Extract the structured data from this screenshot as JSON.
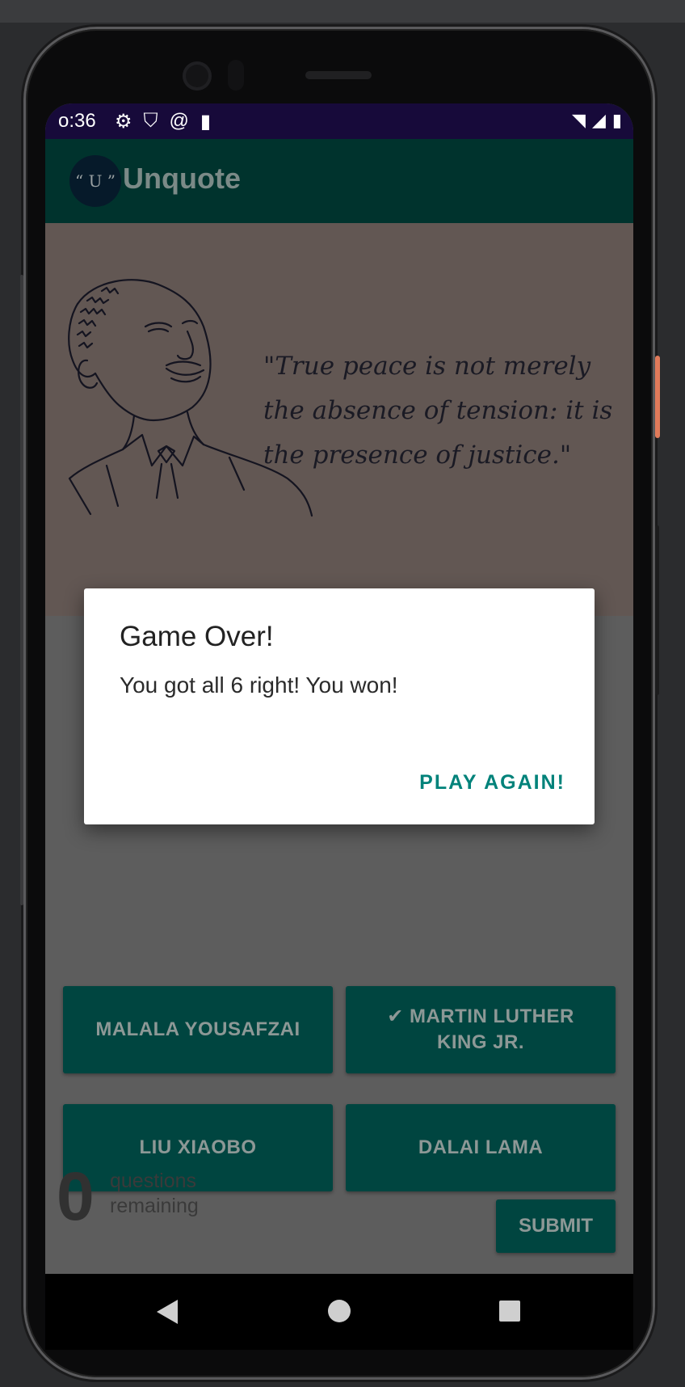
{
  "status_bar": {
    "time": "o:36",
    "left_icons": [
      "gear-icon",
      "shield-icon",
      "at-sign-icon",
      "sd-card-icon"
    ],
    "right_icons": [
      "wifi-icon",
      "signal-icon",
      "battery-icon"
    ]
  },
  "app_bar": {
    "logo_text": "“ U ” P",
    "title": "Unquote"
  },
  "quote": {
    "text": "\"True peace is not merely the absence of tension: it is the presence of justice.\""
  },
  "answers": [
    {
      "label": "MALALA YOUSAFZAI"
    },
    {
      "label": "✔ MARTIN LUTHER KING JR."
    },
    {
      "label": "LIU XIAOBO"
    },
    {
      "label": "DALAI LAMA"
    }
  ],
  "footer": {
    "remaining_count": "0",
    "remaining_label": "questions remaining",
    "submit_label": "SUBMIT"
  },
  "dialog": {
    "title": "Game Over!",
    "message": "You got all 6 right! You won!",
    "action_label": "PLAY AGAIN!"
  },
  "colors": {
    "accent": "#00827a",
    "app_bar": "#00332d",
    "status_bar": "#170a3a",
    "button": "#004540"
  }
}
